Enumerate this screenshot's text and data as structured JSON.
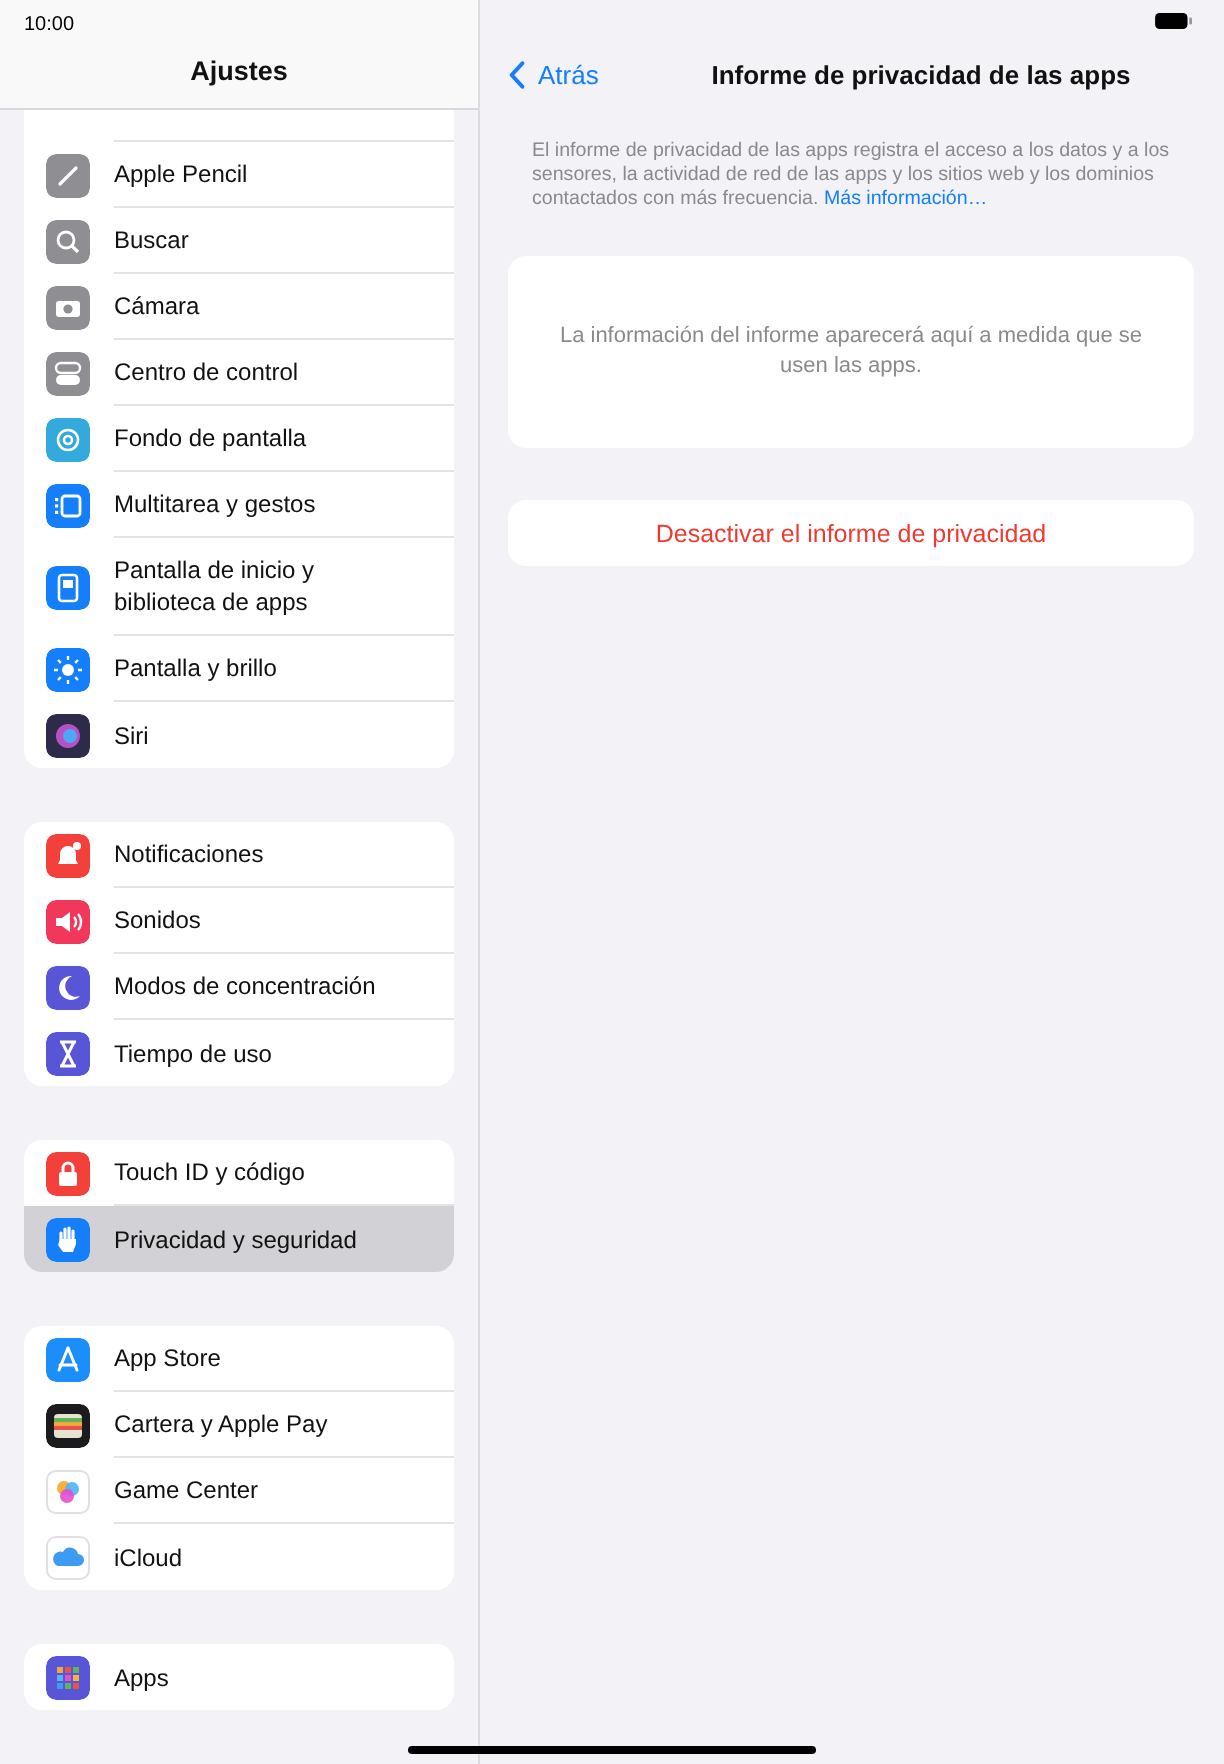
{
  "status_bar": {
    "time": "10:00"
  },
  "sidebar": {
    "title": "Ajustes",
    "groups": [
      {
        "rows": [
          {
            "label": "Apple Pencil",
            "color": "#8e8e93",
            "selected": false
          },
          {
            "label": "Buscar",
            "color": "#8e8e93",
            "selected": false
          },
          {
            "label": "Cámara",
            "color": "#8e8e93",
            "selected": false
          },
          {
            "label": "Centro de control",
            "color": "#8e8e93",
            "selected": false
          },
          {
            "label": "Fondo de pantalla",
            "color": "#34aadc",
            "selected": false
          },
          {
            "label": "Multitarea y gestos",
            "color": "#147efb",
            "selected": false
          },
          {
            "label": "Pantalla de inicio y biblioteca de apps",
            "color": "#147efb",
            "selected": false
          },
          {
            "label": "Pantalla y brillo",
            "color": "#147efb",
            "selected": false
          },
          {
            "label": "Siri",
            "color": "#2c2c4a",
            "selected": false
          }
        ]
      },
      {
        "rows": [
          {
            "label": "Notificaciones",
            "color": "#f4403a",
            "selected": false
          },
          {
            "label": "Sonidos",
            "color": "#f2385a",
            "selected": false
          },
          {
            "label": "Modos de concentración",
            "color": "#5856d6",
            "selected": false
          },
          {
            "label": "Tiempo de uso",
            "color": "#5856d6",
            "selected": false
          }
        ]
      },
      {
        "rows": [
          {
            "label": "Touch ID y código",
            "color": "#f4403a",
            "selected": false
          },
          {
            "label": "Privacidad y seguridad",
            "color": "#147efb",
            "selected": true
          }
        ]
      },
      {
        "rows": [
          {
            "label": "App Store",
            "color": "#1c8ef9",
            "selected": false
          },
          {
            "label": "Cartera y Apple Pay",
            "color": "#1c1c1e",
            "selected": false
          },
          {
            "label": "Game Center",
            "color": "#ffffff",
            "selected": false
          },
          {
            "label": "iCloud",
            "color": "#ffffff",
            "selected": false
          }
        ]
      },
      {
        "rows": [
          {
            "label": "Apps",
            "color": "#5856d6",
            "selected": false
          }
        ]
      }
    ]
  },
  "detail": {
    "back": "Atrás",
    "title": "Informe de privacidad de las apps",
    "description": "El informe de privacidad de las apps registra el acceso a los datos y a los sensores, la actividad de red de las apps y los sitios web y los dominios contactados con más frecuencia.",
    "more_link": "Más información…",
    "empty_message": "La información del informe aparecerá aquí a medida que se usen las apps.",
    "action": "Desactivar el informe de privacidad"
  }
}
